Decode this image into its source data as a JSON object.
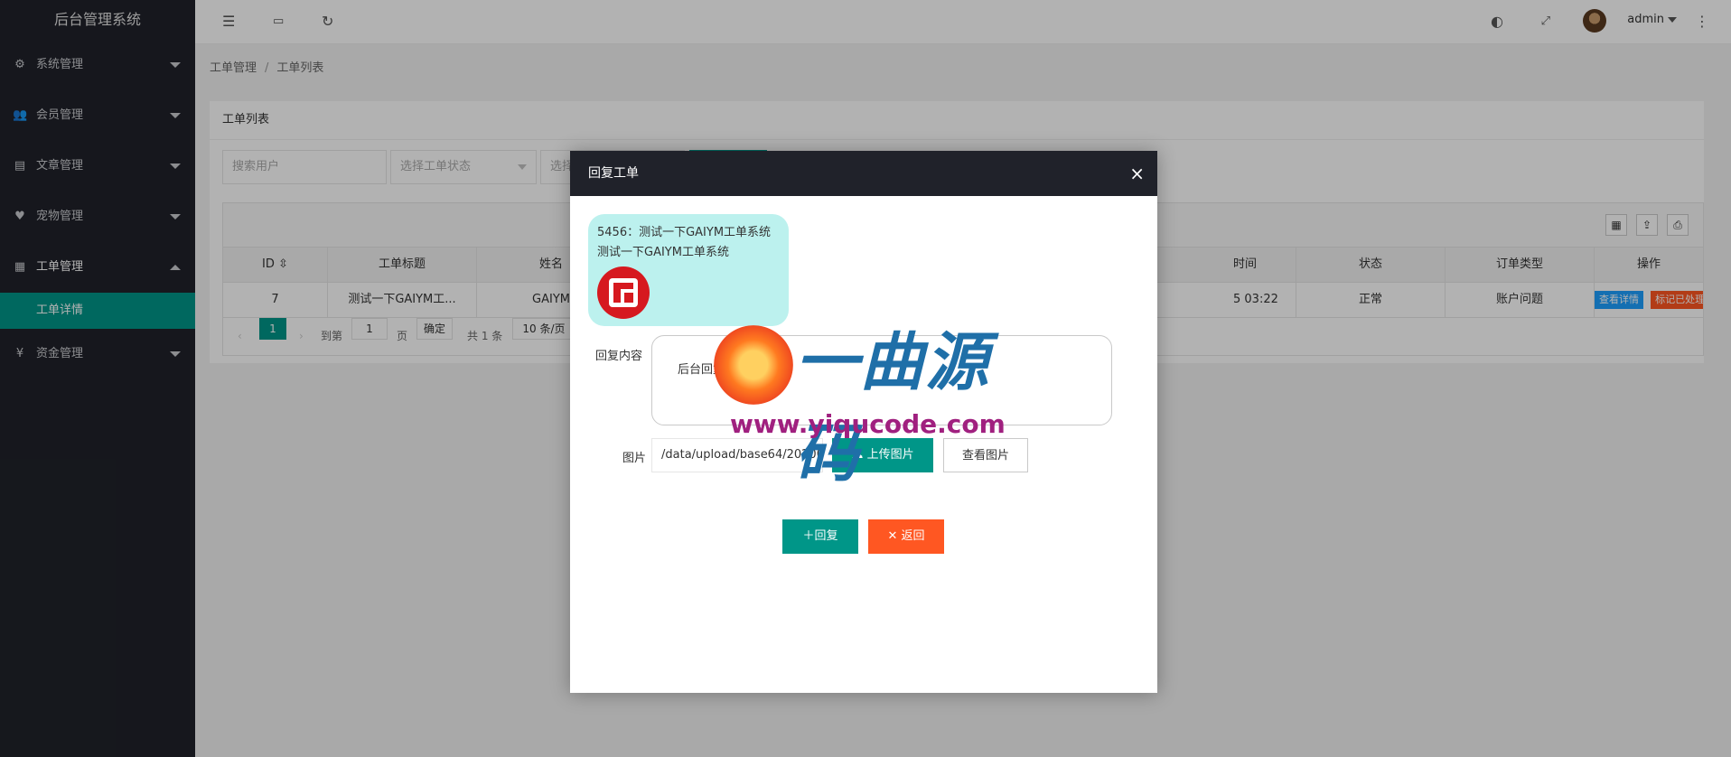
{
  "app": {
    "title": "后台管理系统"
  },
  "sidebar": {
    "items": [
      {
        "label": "系统管理",
        "icon": "gear-icon"
      },
      {
        "label": "会员管理",
        "icon": "users-icon"
      },
      {
        "label": "文章管理",
        "icon": "document-icon"
      },
      {
        "label": "宠物管理",
        "icon": "heart-icon"
      },
      {
        "label": "工单管理",
        "icon": "file-icon",
        "expanded": true,
        "children": [
          {
            "label": "工单详情",
            "active": true
          }
        ]
      },
      {
        "label": "资金管理",
        "icon": "yen-icon"
      }
    ]
  },
  "header": {
    "username": "admin"
  },
  "breadcrumb": {
    "first": "工单管理",
    "sep": "/",
    "current": "工单列表"
  },
  "card": {
    "title": "工单列表"
  },
  "filters": {
    "search_placeholder": "搜索用户",
    "status_placeholder": "选择工单状态",
    "type_placeholder_partial": "选择"
  },
  "table": {
    "columns": [
      "ID",
      "工单标题",
      "姓名",
      "时间",
      "状态",
      "订单类型",
      "操作"
    ],
    "rows": [
      {
        "id": "7",
        "title": "测试一下GAIYM工...",
        "name": "GAIYM",
        "time": "5 03:22",
        "status": "正常",
        "order_type": "账户问题",
        "action_view": "查看详情",
        "action_mark": "标记已处理"
      }
    ]
  },
  "pagination": {
    "current_page": "1",
    "goto_label": "到第",
    "goto_value": "1",
    "page_label": "页",
    "confirm": "确定",
    "total": "共 1 条",
    "page_size": "10 条/页"
  },
  "modal": {
    "title": "回复工单",
    "message_line1": "5456：测试一下GAIYM工单系统",
    "message_line2": "测试一下GAIYM工单系统",
    "reply_label": "回复内容",
    "reply_value": "后台回复",
    "image_label": "图片",
    "image_path": "/data/upload/base64/2020091",
    "upload_button": "上传图片",
    "view_button": "查看图片",
    "submit_button": "回复",
    "back_button": "返回"
  },
  "watermark": {
    "brand": "一曲源码",
    "url": "www.yiqucode.com"
  },
  "colors": {
    "primary": "#009688",
    "danger": "#ff5722",
    "info": "#1e9fff",
    "sidebar": "#20222a"
  }
}
